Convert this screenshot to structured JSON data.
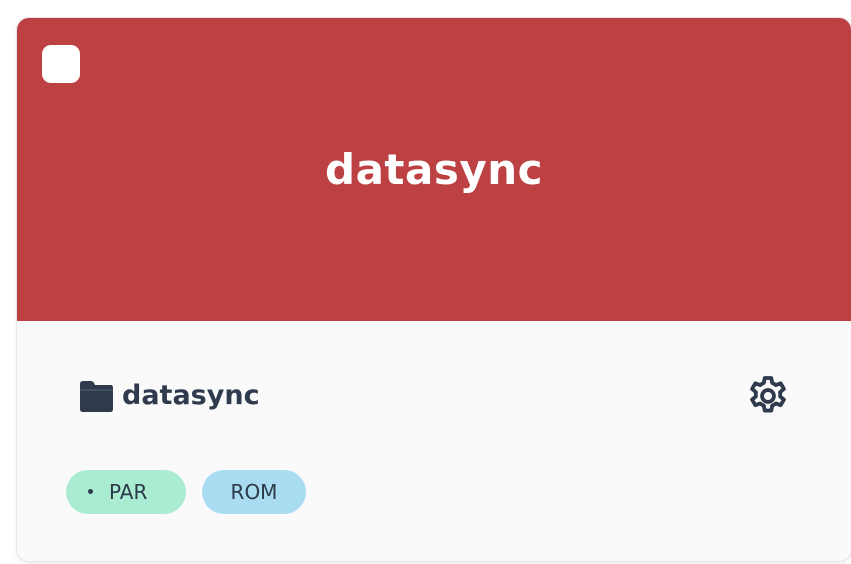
{
  "card": {
    "banner_title": "datasync",
    "banner_color": "#bd4042",
    "repo_name": "datasync",
    "folder_icon": "folder-icon",
    "settings_icon": "gear-icon",
    "checkbox_checked": false,
    "tags": [
      {
        "label": "PAR",
        "color": "#a9ecd2",
        "has_dot": true
      },
      {
        "label": "ROM",
        "color": "#a9dcf1",
        "has_dot": false
      }
    ]
  }
}
